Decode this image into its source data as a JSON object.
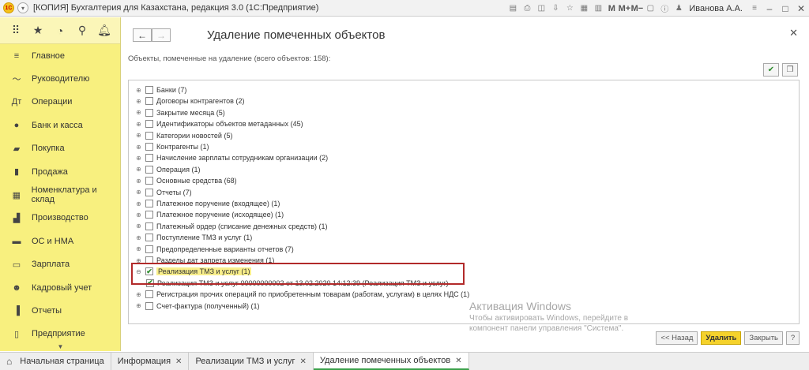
{
  "titlebar": {
    "title": "[КОПИЯ] Бухгалтерия для Казахстана, редакция 3.0  (1С:Предприятие)",
    "user": "Иванова А.А."
  },
  "sidebar": {
    "items": [
      {
        "label": "Главное"
      },
      {
        "label": "Руководителю"
      },
      {
        "label": "Операции"
      },
      {
        "label": "Банк и касса"
      },
      {
        "label": "Покупка"
      },
      {
        "label": "Продажа"
      },
      {
        "label": "Номенклатура и склад"
      },
      {
        "label": "Производство"
      },
      {
        "label": "ОС и НМА"
      },
      {
        "label": "Зарплата"
      },
      {
        "label": "Кадровый учет"
      },
      {
        "label": "Отчеты"
      },
      {
        "label": "Предприятие"
      }
    ]
  },
  "main": {
    "title": "Удаление помеченных объектов",
    "subtitle": "Объекты, помеченные на удаление (всего объектов: 158):",
    "tree": [
      {
        "label": "Банки (7)",
        "checked": false,
        "expanded": false
      },
      {
        "label": "Договоры контрагентов (2)",
        "checked": false,
        "expanded": false
      },
      {
        "label": "Закрытие месяца (5)",
        "checked": false,
        "expanded": false
      },
      {
        "label": "Идентификаторы объектов метаданных (45)",
        "checked": false,
        "expanded": false
      },
      {
        "label": "Категории новостей (5)",
        "checked": false,
        "expanded": false
      },
      {
        "label": "Контрагенты (1)",
        "checked": false,
        "expanded": false
      },
      {
        "label": "Начисление зарплаты сотрудникам организации (2)",
        "checked": false,
        "expanded": false
      },
      {
        "label": "Операция (1)",
        "checked": false,
        "expanded": false
      },
      {
        "label": "Основные средства (68)",
        "checked": false,
        "expanded": false
      },
      {
        "label": "Отчеты (7)",
        "checked": false,
        "expanded": false
      },
      {
        "label": "Платежное поручение (входящее) (1)",
        "checked": false,
        "expanded": false
      },
      {
        "label": "Платежное поручение (исходящее) (1)",
        "checked": false,
        "expanded": false
      },
      {
        "label": "Платежный ордер (списание денежных средств) (1)",
        "checked": false,
        "expanded": false
      },
      {
        "label": "Поступление ТМЗ и услуг (1)",
        "checked": false,
        "expanded": false
      },
      {
        "label": "Предопределенные варианты отчетов (7)",
        "checked": false,
        "expanded": false
      },
      {
        "label": "Разделы дат запрета изменения (1)",
        "checked": false,
        "expanded": false
      },
      {
        "label": "Реализация ТМЗ и услуг (1)",
        "checked": true,
        "expanded": true,
        "selected": true
      },
      {
        "label": "Реализация ТМЗ и услуг 00000000002 от 13.02.2020 14:12:39 (Реализация ТМЗ и услуг)",
        "checked": true,
        "child": true
      },
      {
        "label": "Регистрация прочих операций по приобретенным товарам (работам, услугам) в целях НДС (1)",
        "checked": false,
        "expanded": false
      },
      {
        "label": "Счет-фактура (полученный) (1)",
        "checked": false,
        "expanded": false
      }
    ],
    "buttons": {
      "back": "<< Назад",
      "delete": "Удалить",
      "close": "Закрыть",
      "help": "?"
    }
  },
  "watermark": {
    "line1": "Активация Windows",
    "line2": "Чтобы активировать Windows, перейдите в",
    "line3": "компонент панели управления \"Система\"."
  },
  "tabs": [
    {
      "label": "Начальная страница",
      "closable": false
    },
    {
      "label": "Информация",
      "closable": true
    },
    {
      "label": "Реализации ТМЗ и услуг",
      "closable": true
    },
    {
      "label": "Удаление помеченных объектов",
      "closable": true,
      "active": true
    }
  ]
}
